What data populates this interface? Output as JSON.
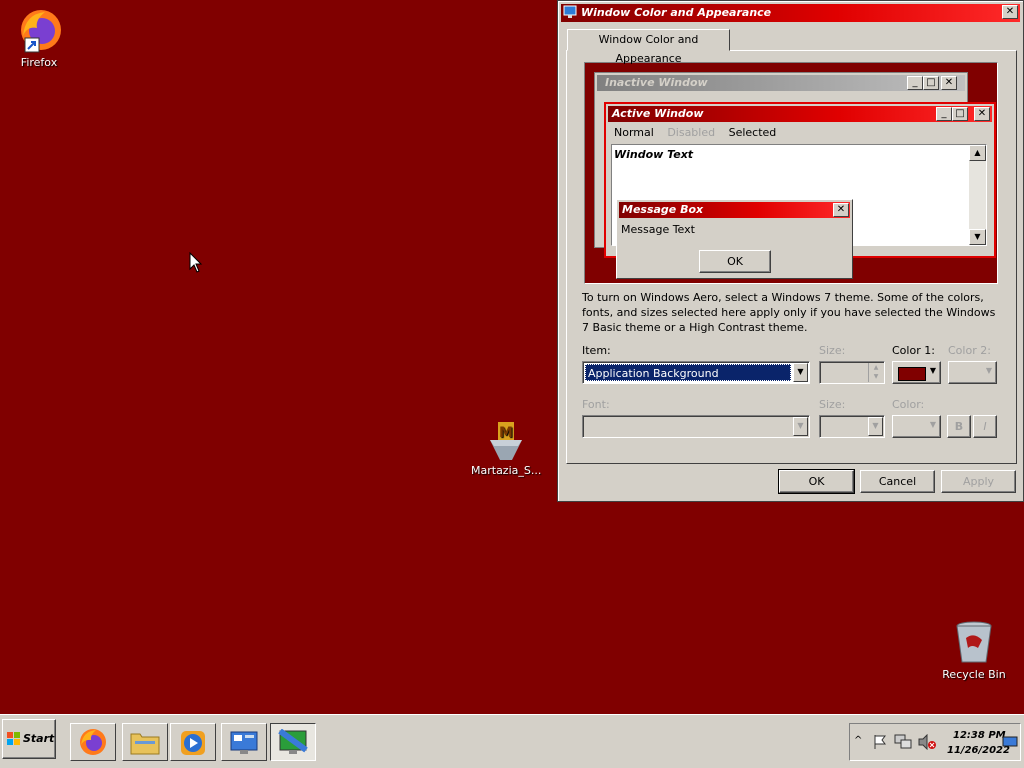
{
  "desktop": {
    "background": "#800000",
    "icons": [
      {
        "label": "Firefox"
      },
      {
        "label": "Martazia_S..."
      },
      {
        "label": "Recycle Bin"
      }
    ]
  },
  "dialog": {
    "title": "Window Color and Appearance",
    "tab": "Window Color and Appearance",
    "preview": {
      "inactive_title": "Inactive Window",
      "active_title": "Active Window",
      "menu": [
        "Normal",
        "Disabled",
        "Selected"
      ],
      "window_text": "Window Text",
      "msg_title": "Message Box",
      "msg_text": "Message Text",
      "msg_ok": "OK"
    },
    "info": "To turn on Windows Aero, select a Windows 7 theme.  Some of the colors, fonts, and sizes selected here apply only if you have selected the Windows 7 Basic theme or a High Contrast theme.",
    "item_label": "Item:",
    "item_value": "Application Background",
    "size_label": "Size:",
    "color1_label": "Color 1:",
    "color2_label": "Color 2:",
    "color1_value": "#800000",
    "font_label": "Font:",
    "font_size_label": "Size:",
    "font_color_label": "Color:",
    "bold": "B",
    "italic": "I",
    "ok": "OK",
    "cancel": "Cancel",
    "apply": "Apply"
  },
  "taskbar": {
    "start": "Start",
    "time": "12:38 PM",
    "date": "11/26/2022"
  }
}
